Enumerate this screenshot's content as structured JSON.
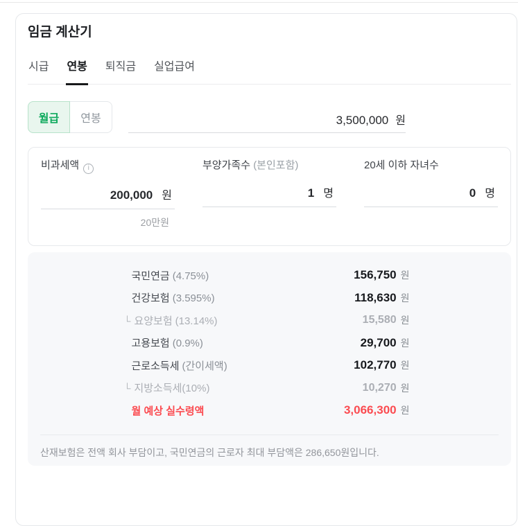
{
  "colors": {
    "accent_green": "#10aa5e",
    "accent_green_bg": "#e9f6ee",
    "highlight_red": "#fb4b50",
    "results_bg": "#f7f8fa"
  },
  "icons": {
    "info": "i",
    "sub_branch": "└"
  },
  "calculator": {
    "title": "임금 계산기",
    "tabs": [
      {
        "label": "시급",
        "active": false
      },
      {
        "label": "연봉",
        "active": true
      },
      {
        "label": "퇴직금",
        "active": false
      },
      {
        "label": "실업급여",
        "active": false
      }
    ],
    "pay_type_toggle": {
      "options": [
        {
          "label": "월급",
          "selected": true
        },
        {
          "label": "연봉",
          "selected": false
        }
      ]
    },
    "salary_input": {
      "value": "3,500,000",
      "unit": "원"
    },
    "fields": {
      "tax_free": {
        "label": "비과세액",
        "value": "200,000",
        "unit": "원",
        "hint": "20만원"
      },
      "dependents": {
        "label": "부양가족수",
        "sublabel": "(본인포함)",
        "value": "1",
        "unit": "명"
      },
      "children": {
        "label": "20세 이하 자녀수",
        "value": "0",
        "unit": "명"
      }
    },
    "results": {
      "rows": [
        {
          "label": "국민연금",
          "rate": "(4.75%)",
          "value": "156,750",
          "unit": "원",
          "type": "main"
        },
        {
          "label": "건강보험",
          "rate": "(3.595%)",
          "value": "118,630",
          "unit": "원",
          "type": "main"
        },
        {
          "label": "요양보험",
          "rate": "(13.14%)",
          "value": "15,580",
          "unit": "원",
          "type": "sub"
        },
        {
          "label": "고용보험",
          "rate": "(0.9%)",
          "value": "29,700",
          "unit": "원",
          "type": "main"
        },
        {
          "label": "근로소득세",
          "rate": "(간이세액)",
          "value": "102,770",
          "unit": "원",
          "type": "main"
        },
        {
          "label": "지방소득세(10%)",
          "rate": "",
          "value": "10,270",
          "unit": "원",
          "type": "sub"
        },
        {
          "label": "월 예상 실수령액",
          "rate": "",
          "value": "3,066,300",
          "unit": "원",
          "type": "total"
        }
      ],
      "footnote": "산재보험은 전액 회사 부담이고, 국민연금의 근로자 최대 부담액은 286,650원입니다."
    }
  }
}
